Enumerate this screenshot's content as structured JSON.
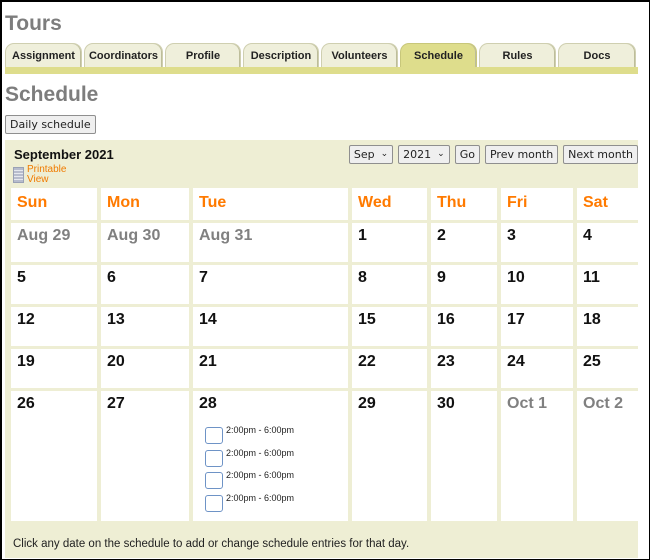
{
  "app": {
    "title": "Tours"
  },
  "tabs": [
    {
      "label": "Assignment",
      "active": false
    },
    {
      "label": "Coordinators",
      "active": false
    },
    {
      "label": "Profile",
      "active": false
    },
    {
      "label": "Description",
      "active": false
    },
    {
      "label": "Volunteers",
      "active": false
    },
    {
      "label": "Schedule",
      "active": true
    },
    {
      "label": "Rules",
      "active": false
    },
    {
      "label": "Docs",
      "active": false
    }
  ],
  "section": {
    "title": "Schedule",
    "daily_button": "Daily schedule"
  },
  "calendar": {
    "month_title": "September 2021",
    "printable_view": [
      "Printable",
      "View"
    ],
    "printable_icon": "document-icon",
    "month_select": "Sep",
    "year_select": "2021",
    "go_label": "Go",
    "prev_label": "Prev month",
    "next_label": "Next month",
    "weekdays": [
      "Sun",
      "Mon",
      "Tue",
      "Wed",
      "Thu",
      "Fri",
      "Sat"
    ],
    "weeks": [
      [
        {
          "label": "Aug 29",
          "other": true
        },
        {
          "label": "Aug 30",
          "other": true
        },
        {
          "label": "Aug 31",
          "other": true
        },
        {
          "label": "1"
        },
        {
          "label": "2"
        },
        {
          "label": "3"
        },
        {
          "label": "4"
        }
      ],
      [
        {
          "label": "5"
        },
        {
          "label": "6"
        },
        {
          "label": "7"
        },
        {
          "label": "8"
        },
        {
          "label": "9"
        },
        {
          "label": "10"
        },
        {
          "label": "11"
        }
      ],
      [
        {
          "label": "12"
        },
        {
          "label": "13"
        },
        {
          "label": "14"
        },
        {
          "label": "15"
        },
        {
          "label": "16"
        },
        {
          "label": "17"
        },
        {
          "label": "18"
        }
      ],
      [
        {
          "label": "19"
        },
        {
          "label": "20"
        },
        {
          "label": "21"
        },
        {
          "label": "22"
        },
        {
          "label": "23"
        },
        {
          "label": "24"
        },
        {
          "label": "25"
        }
      ],
      [
        {
          "label": "26"
        },
        {
          "label": "27"
        },
        {
          "label": "28",
          "entries": [
            "2:00pm - 6:00pm",
            "2:00pm - 6:00pm",
            "2:00pm - 6:00pm",
            "2:00pm - 6:00pm"
          ]
        },
        {
          "label": "29"
        },
        {
          "label": "30"
        },
        {
          "label": "Oct 1",
          "other": true
        },
        {
          "label": "Oct 2",
          "other": true
        }
      ]
    ],
    "footer_note": "Click any date on the schedule to add or change schedule entries for that day."
  },
  "colors": {
    "tab_active": "#dedd8c",
    "tab_inactive": "#efefdb",
    "calendar_bg": "#eeeed4",
    "weekday_text": "#ff7a00",
    "muted_day": "#808080",
    "heading_gray": "#7d7d7d"
  }
}
